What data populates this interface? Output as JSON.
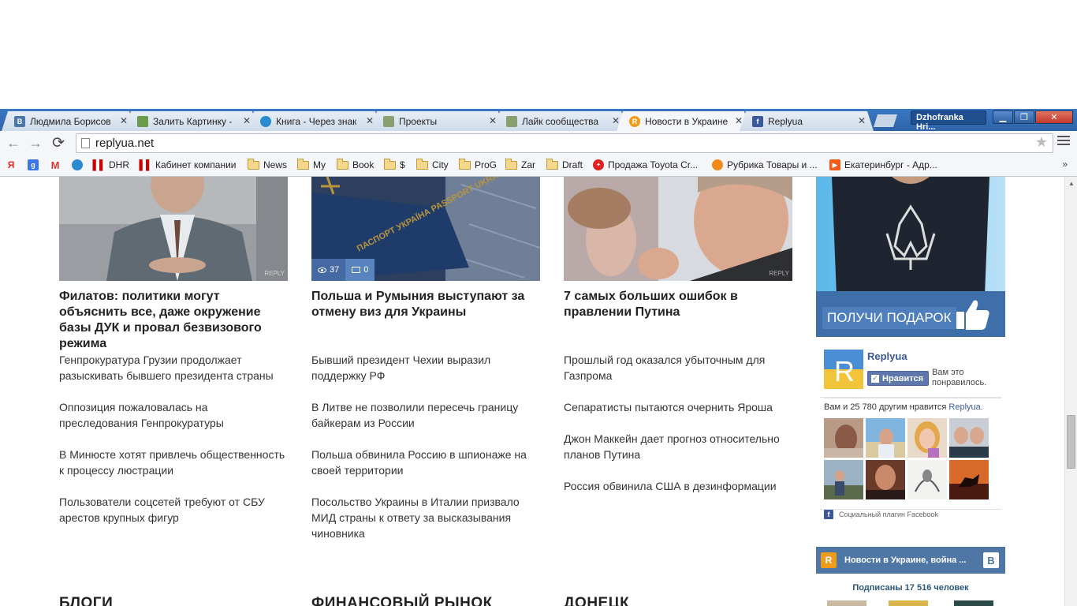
{
  "tabs": [
    {
      "title": "Людмила Борисов",
      "icon": "vk-icon",
      "color": "#4a76a8"
    },
    {
      "title": "Залить Картинку -",
      "icon": "image-icon",
      "color": "#6a9a4a"
    },
    {
      "title": "Книга - Через знак",
      "icon": "book-icon",
      "color": "#2a8ad0"
    },
    {
      "title": "Проекты",
      "icon": "projects-icon",
      "color": "#8aa070"
    },
    {
      "title": "Лайк сообщества",
      "icon": "like-icon",
      "color": "#8aa070"
    },
    {
      "title": "Новости в Украине",
      "icon": "replyua-icon",
      "color": "#f29a1a",
      "active": true
    },
    {
      "title": "Replyua",
      "icon": "facebook-icon",
      "color": "#3b5998"
    }
  ],
  "window": {
    "user": "Dzhofranka Hri..."
  },
  "address": {
    "url": "replyua.net"
  },
  "bookmarks": [
    {
      "label": "",
      "icon": "yandex-icon",
      "color": "#e22"
    },
    {
      "label": "",
      "icon": "google-icon",
      "color": "#3b78e7"
    },
    {
      "label": "",
      "icon": "gmail-icon",
      "color": "#d33"
    },
    {
      "label": "",
      "icon": "site-icon",
      "color": "#2a8ad0"
    },
    {
      "label": "DHR",
      "icon": "bars-icon",
      "color": "#c00"
    },
    {
      "label": "Кабинет компании",
      "icon": "bars-icon",
      "color": "#c00"
    },
    {
      "label": "News",
      "icon": "folder-icon"
    },
    {
      "label": "My",
      "icon": "folder-icon"
    },
    {
      "label": "Book",
      "icon": "folder-icon"
    },
    {
      "label": "$",
      "icon": "folder-icon"
    },
    {
      "label": "City",
      "icon": "folder-icon"
    },
    {
      "label": "ProG",
      "icon": "folder-icon"
    },
    {
      "label": "Zar",
      "icon": "folder-icon"
    },
    {
      "label": "Draft",
      "icon": "folder-icon"
    },
    {
      "label": "Продажа Toyota Cr...",
      "icon": "toyota-icon",
      "color": "#d22"
    },
    {
      "label": "Рубрика Товары и ...",
      "icon": "bulb-icon",
      "color": "#f08a1a"
    },
    {
      "label": "Екатеринбург - Адр...",
      "icon": "arrow-icon",
      "color": "#f05a1a"
    }
  ],
  "bookmarks_more": "»",
  "columns": [
    {
      "headline": "Филатов: политики могут объяснить все, даже окружение базы ДУК и провал безвизового режима",
      "credit": "REPLY",
      "items": [
        "Генпрокуратура Грузии продолжает разыскивать бывшего президента страны",
        "Оппозиция пожаловалась на преследования Генпрокуратуры",
        "В Минюсте хотят привлечь общественность к процессу люстрации",
        "Пользователи соцсетей требуют от СБУ арестов крупных фигур"
      ],
      "section": "БЛОГИ"
    },
    {
      "headline": "Польша и Румыния выступают за отмену виз для Украины",
      "views": "37",
      "comments": "0",
      "passport_text": "ПАСПОРТ УКРАЇНА PASSPORT UKRAINE",
      "items": [
        "Бывший президент Чехии выразил поддержку РФ",
        "В Литве не позволили пересечь границу байкерам из России",
        "Польша обвинила Россию в шпионаже на своей территории",
        "Посольство Украины в Италии призвало МИД страны к ответу за высказывания чиновника"
      ],
      "section": "ФИНАНСОВЫЙ РЫНОК"
    },
    {
      "headline": "7 самых больших ошибок в правлении Путина",
      "credit": "REPLY",
      "items": [
        "Прошлый год оказался убыточным для Газпрома",
        "Сепаратисты пытаются очернить Яроша",
        "Джон Маккейн дает прогноз относительно планов Путина",
        "Россия обвинила США в дезинформации"
      ],
      "section": "ДОНЕЦК"
    }
  ],
  "promo": {
    "button": "ПОЛУЧИ ПОДАРОК"
  },
  "facebook": {
    "page_name": "Replyua",
    "logo_letter": "R",
    "like_button": "Нравится",
    "liked_text": "Вам это понравилось.",
    "count_prefix": "Вам и 25 780 другим нравится",
    "count_link": "Replyua.",
    "plugin": "Социальный плагин Facebook"
  },
  "vk": {
    "logo_letter": "R",
    "title": "Новости в Украине, война ...",
    "icon_letter": "B",
    "subscribers": "Подписаны 17 516 человек"
  },
  "colors": {
    "tabbar": "#2e64a8",
    "accent_blue": "#3f6fa8",
    "facebook": "#3b5998",
    "vk": "#4f77a6",
    "replyua_orange": "#f29a1a"
  }
}
